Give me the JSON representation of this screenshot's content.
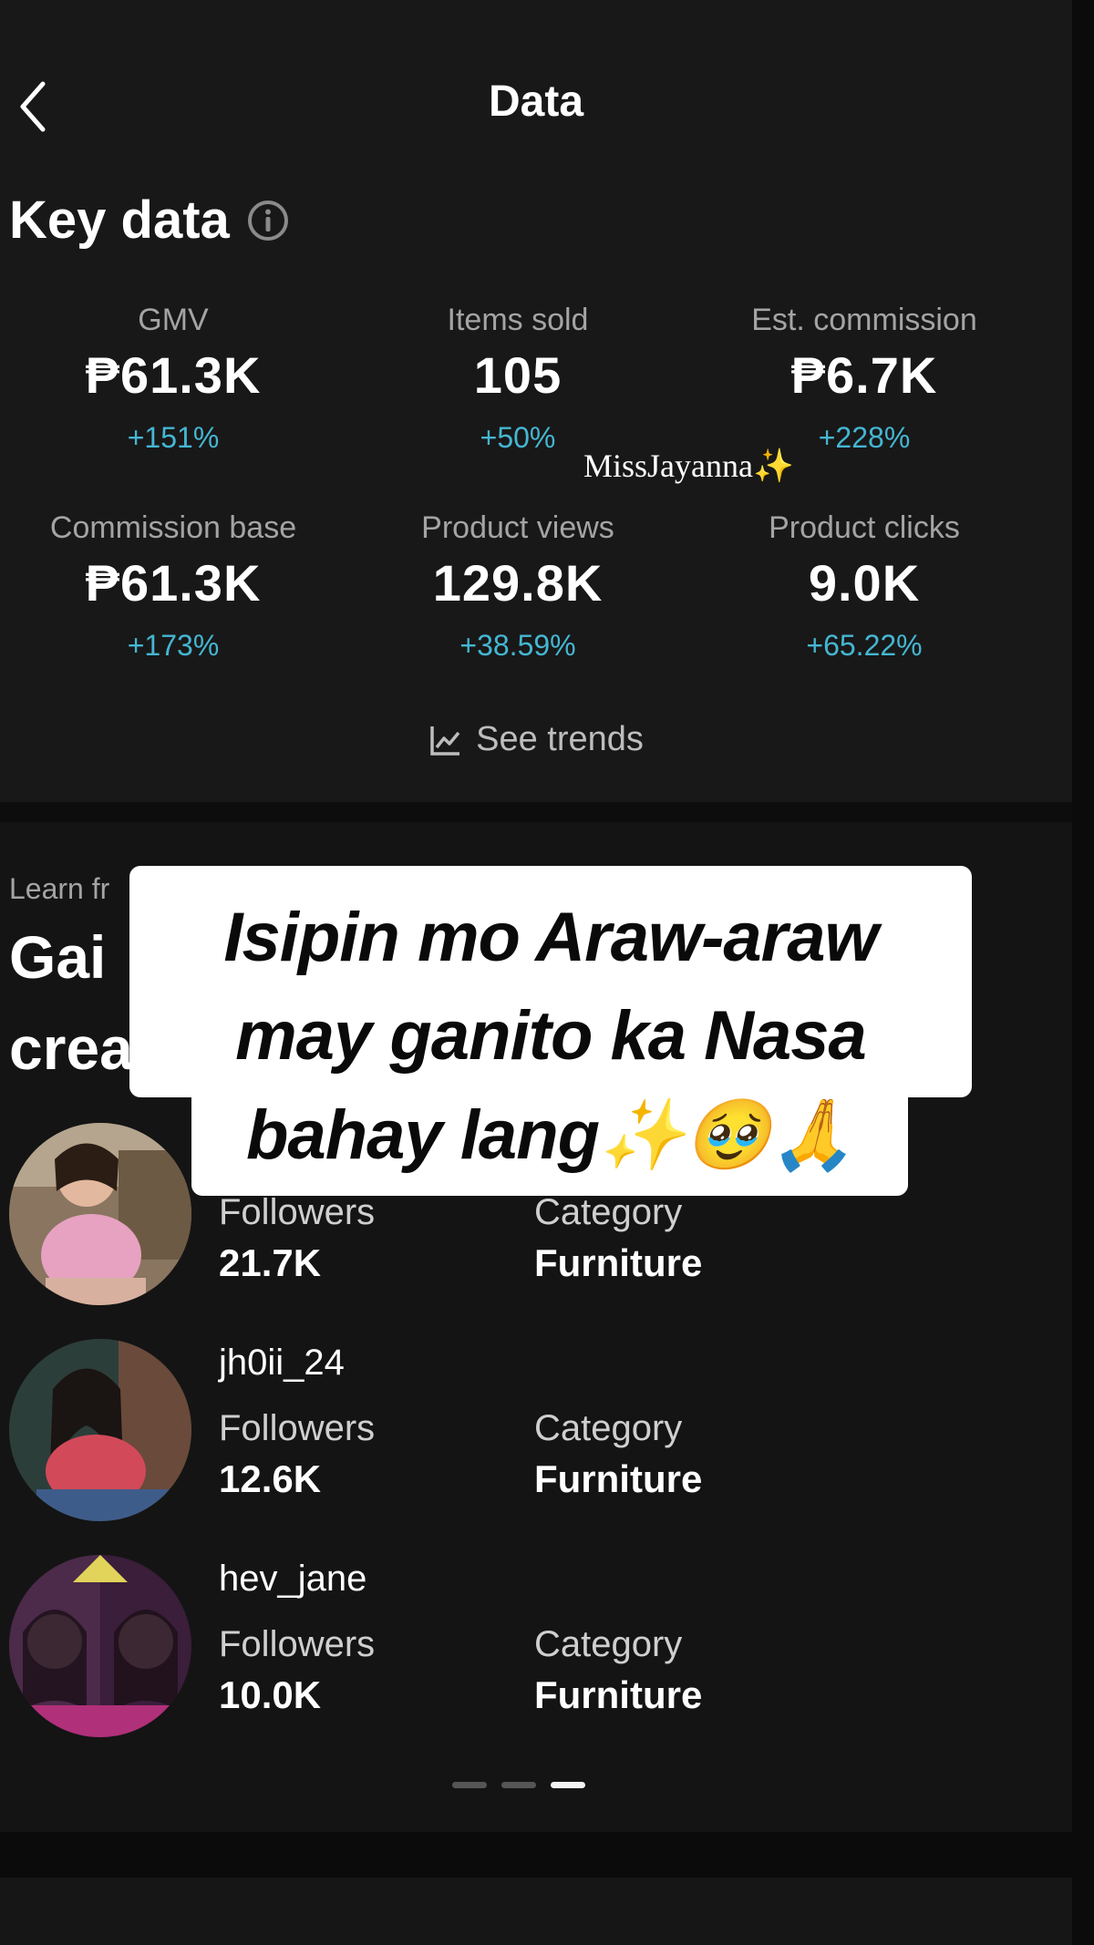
{
  "header": {
    "title": "Data"
  },
  "key_data": {
    "title": "Key data"
  },
  "metrics": [
    {
      "label": "GMV",
      "value": "₱61.3K",
      "change": "+151%"
    },
    {
      "label": "Items sold",
      "value": "105",
      "change": "+50%"
    },
    {
      "label": "Est. commission",
      "value": "₱6.7K",
      "change": "+228%"
    },
    {
      "label": "Commission base",
      "value": "₱61.3K",
      "change": "+173%"
    },
    {
      "label": "Product views",
      "value": "129.8K",
      "change": "+38.59%"
    },
    {
      "label": "Product clicks",
      "value": "9.0K",
      "change": "+65.22%"
    }
  ],
  "see_trends": "See trends",
  "learn": {
    "label": "Learn fr",
    "heading_line1": "Gai",
    "heading_line2": "crea"
  },
  "creators": [
    {
      "name": "",
      "followers_label": "Followers",
      "followers": "21.7K",
      "category_label": "Category",
      "category": "Furniture"
    },
    {
      "name": "jh0ii_24",
      "followers_label": "Followers",
      "followers": "12.6K",
      "category_label": "Category",
      "category": "Furniture"
    },
    {
      "name": "hev_jane",
      "followers_label": "Followers",
      "followers": "10.0K",
      "category_label": "Category",
      "category": "Furniture"
    }
  ],
  "pagination": {
    "total": 3,
    "active_index": 2
  },
  "overlay": {
    "line1": "Isipin mo Araw-araw",
    "line2": "may ganito ka Nasa",
    "line3": "bahay lang✨🥹🙏"
  },
  "watermark": "MissJayanna✨",
  "colors": {
    "accent": "#45b6d2",
    "background": "#181818"
  }
}
